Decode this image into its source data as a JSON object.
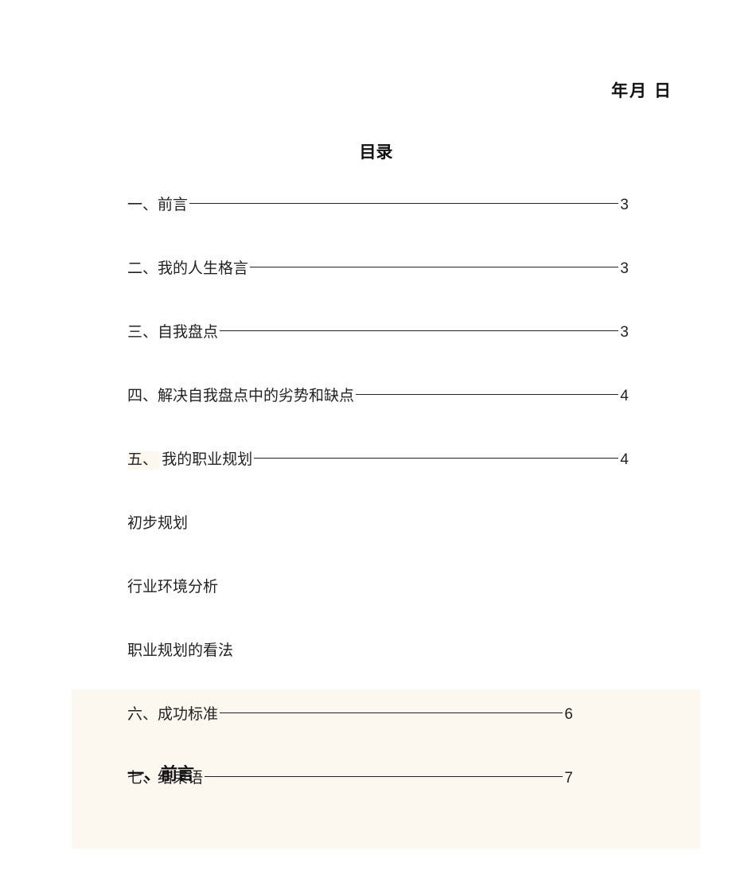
{
  "header": {
    "date_label": "年月 日"
  },
  "toc": {
    "title": "目录",
    "items": [
      {
        "label": "一、前言",
        "page": "3",
        "leader": true,
        "highlight_prefix": ""
      },
      {
        "label": "二、我的人生格言",
        "page": "3",
        "leader": true,
        "highlight_prefix": ""
      },
      {
        "label": "三、自我盘点",
        "page": "3",
        "leader": true,
        "highlight_prefix": ""
      },
      {
        "label": "四、解决自我盘点中的劣势和缺点",
        "page": "4",
        "leader": true,
        "highlight_prefix": ""
      },
      {
        "label": "我的职业规划",
        "page": "4",
        "leader": true,
        "highlight_prefix": "五、"
      },
      {
        "label": "初步规划",
        "page": "",
        "leader": false,
        "highlight_prefix": ""
      },
      {
        "label": "行业环境分析",
        "page": "",
        "leader": false,
        "highlight_prefix": ""
      },
      {
        "label": "职业规划的看法",
        "page": "",
        "leader": false,
        "highlight_prefix": ""
      },
      {
        "label": "成功标准",
        "page": "6",
        "leader": true,
        "highlight_prefix": "六、",
        "short": true
      },
      {
        "label": "结束语",
        "page": "7",
        "leader": true,
        "highlight_prefix": "七、",
        "short": true
      }
    ]
  },
  "section_heading": "一、前言"
}
